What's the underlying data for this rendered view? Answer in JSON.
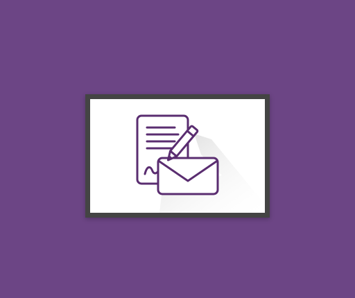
{
  "colors": {
    "background": "#6c4585",
    "frame": "#444444",
    "card": "#ffffff",
    "icon_stroke": "#5a2d70",
    "long_shadow": "#d9d9d9"
  },
  "icons": {
    "main": "document-pen-envelope-icon"
  }
}
